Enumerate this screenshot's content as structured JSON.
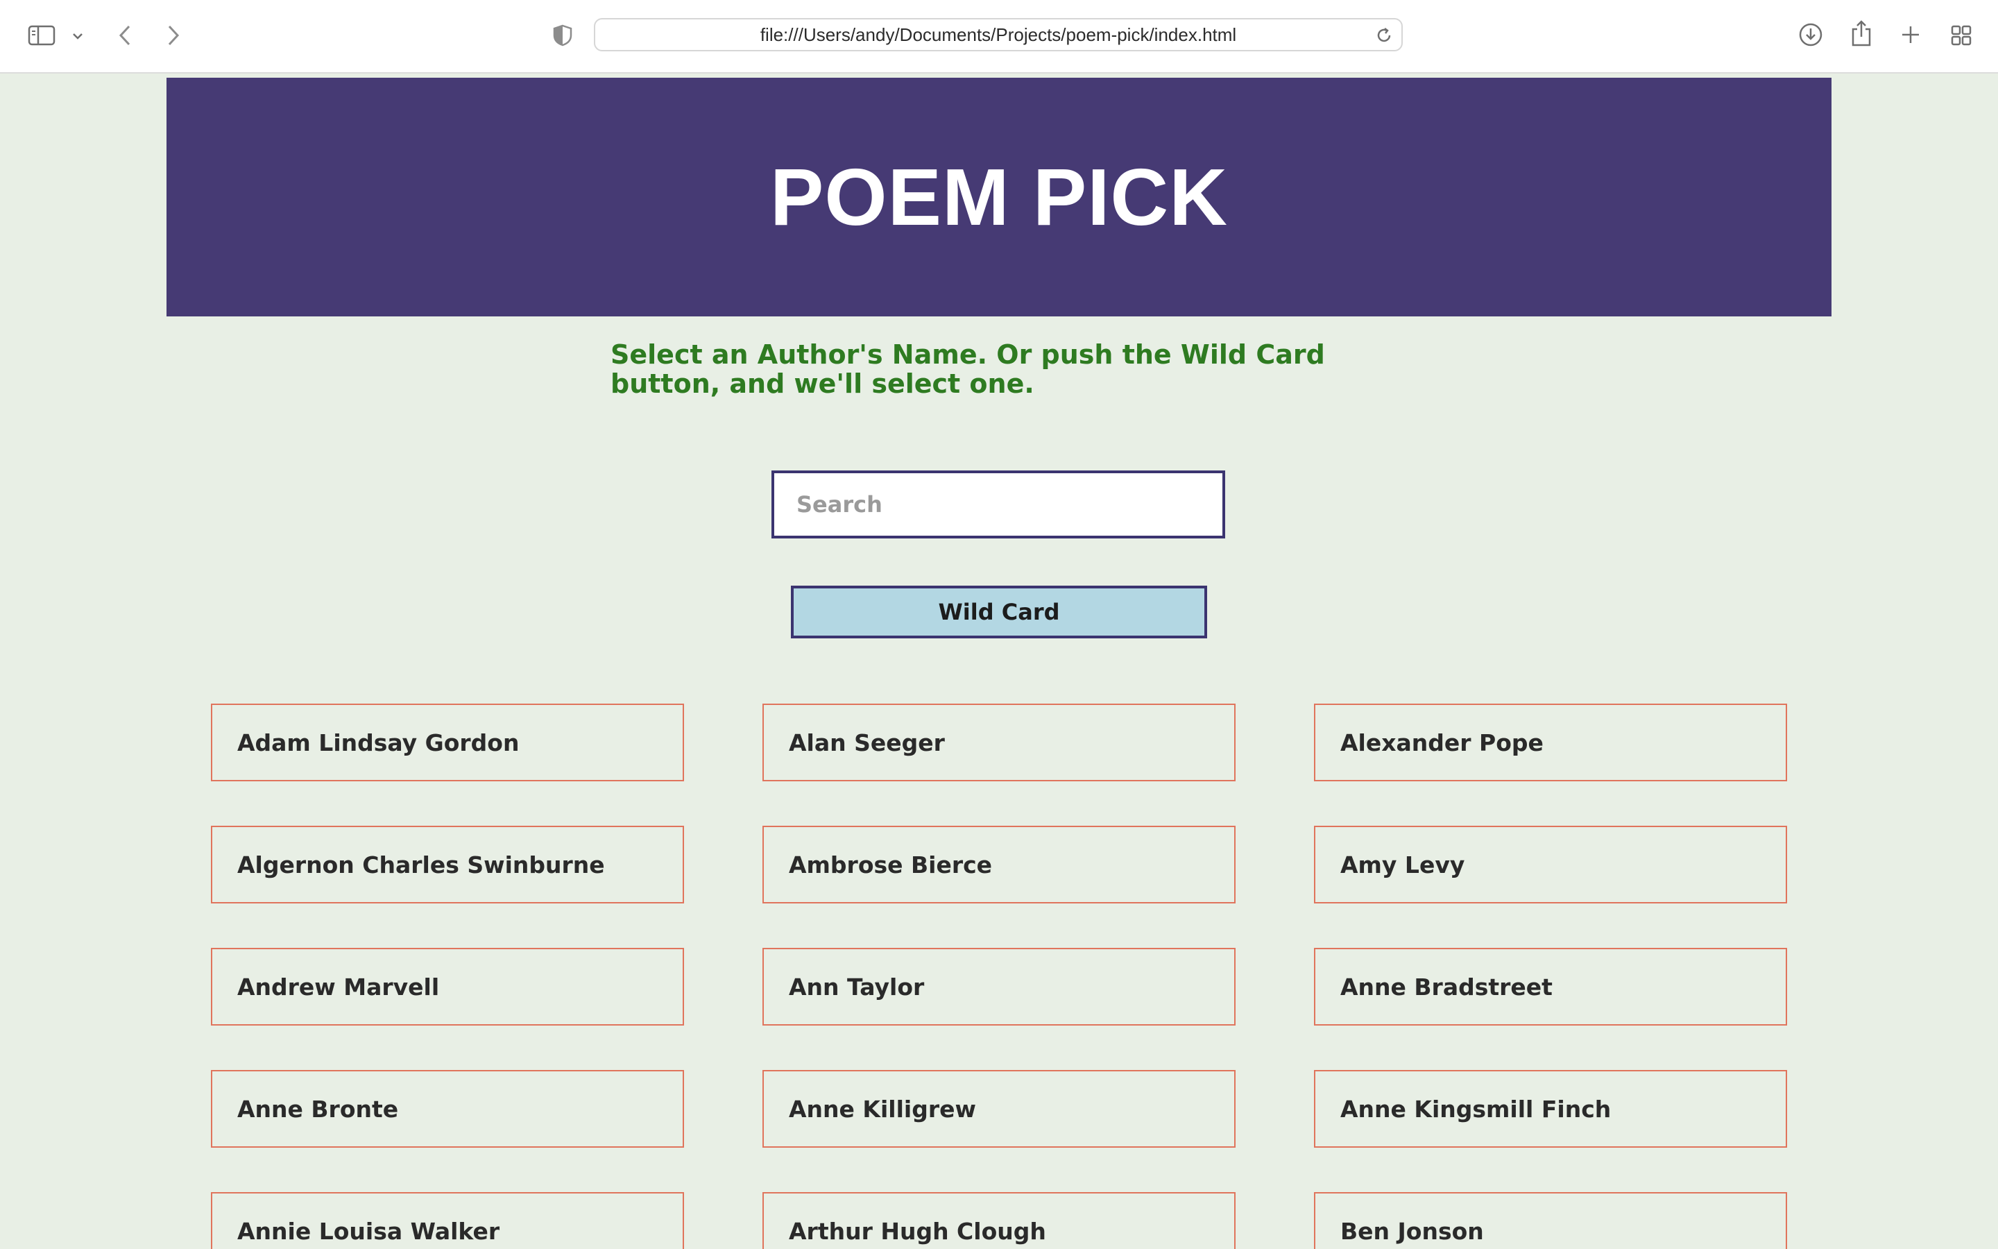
{
  "browser": {
    "url": "file:///Users/andy/Documents/Projects/poem-pick/index.html",
    "icons": {
      "sidebar": "sidebar-icon",
      "sidebar_menu": "chevron-down-icon",
      "back": "chevron-left-icon",
      "forward": "chevron-right-icon",
      "privacy": "shield-icon",
      "reload": "reload-icon",
      "downloads": "download-icon",
      "share": "share-icon",
      "new_tab": "plus-icon",
      "tab_overview": "grid-icon"
    }
  },
  "header": {
    "title": "POEM PICK",
    "background_color": "#463a74"
  },
  "instructions": "Select an Author's Name. Or push the Wild Card button, and we'll select one.",
  "search": {
    "placeholder": "Search",
    "value": ""
  },
  "wild_card": {
    "label": "Wild Card",
    "background_color": "#b3d7e3"
  },
  "authors": [
    "Adam Lindsay Gordon",
    "Alan Seeger",
    "Alexander Pope",
    "Algernon Charles Swinburne",
    "Ambrose Bierce",
    "Amy Levy",
    "Andrew Marvell",
    "Ann Taylor",
    "Anne Bradstreet",
    "Anne Bronte",
    "Anne Killigrew",
    "Anne Kingsmill Finch",
    "Annie Louisa Walker",
    "Arthur Hugh Clough",
    "Ben Jonson"
  ],
  "colors": {
    "page_background": "#e8efe5",
    "instruction_text": "#2e7b21",
    "card_border": "#e0745c"
  }
}
